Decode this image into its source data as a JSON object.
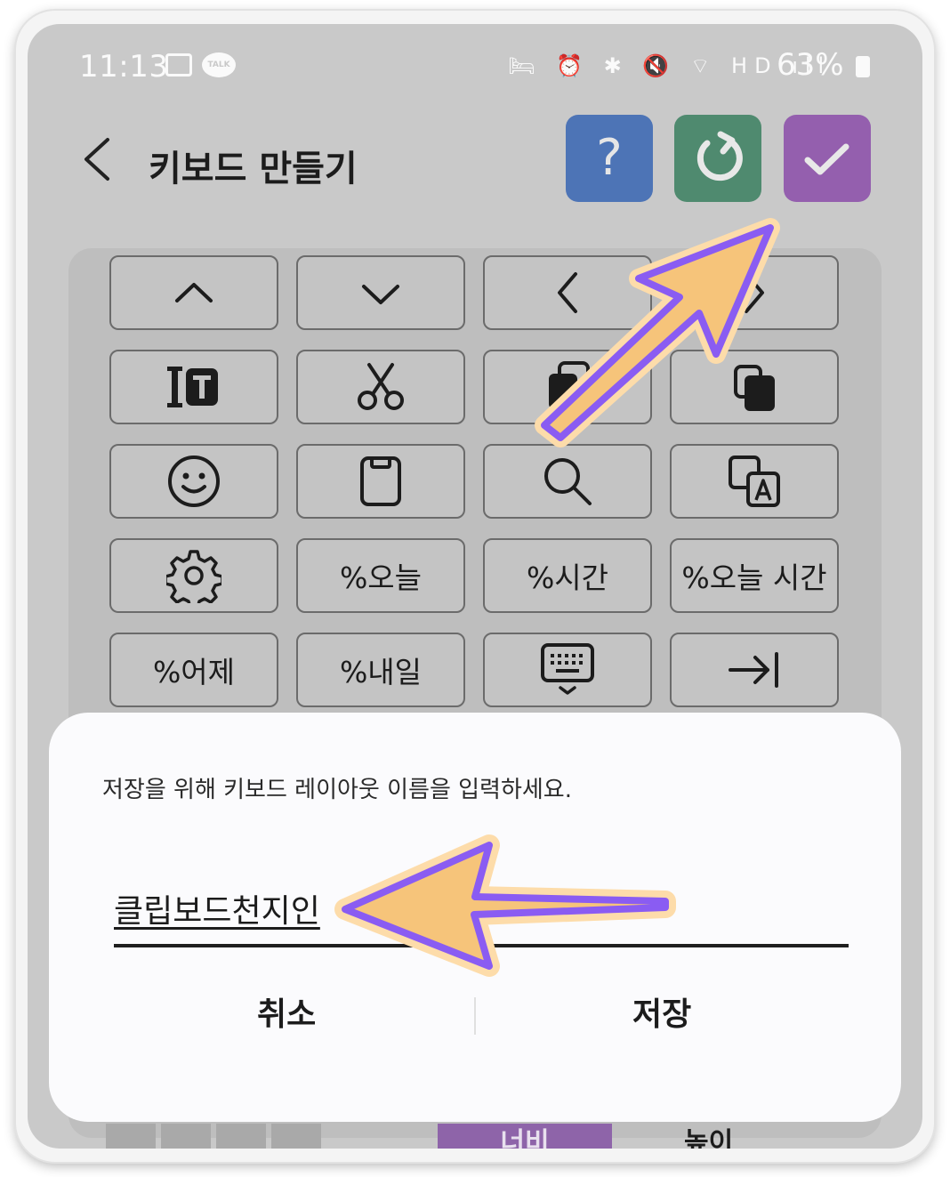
{
  "status_bar": {
    "time": "11:13",
    "talk_label": "TALK",
    "right_icons": "🛏 ⏰ ✱ 🔇 ⌔ HD ıll",
    "battery": "63%"
  },
  "app_bar": {
    "back_icon": "chevron-left-icon",
    "title": "키보드 만들기",
    "help_label": "?",
    "reset_icon": "refresh-icon",
    "confirm_icon": "check-icon",
    "colors": {
      "help": "#4d74b6",
      "reset": "#4f8a6f",
      "confirm": "#945fae"
    }
  },
  "keys": {
    "row1": [
      "chevron-up-icon",
      "chevron-down-icon",
      "chevron-left-icon",
      "chevron-right-icon"
    ],
    "row2": [
      "text-style-icon",
      "scissors-icon",
      "copy-icon",
      "paste-icon"
    ],
    "row3": [
      "emoji-icon",
      "clipboard-icon",
      "search-icon",
      "translate-icon"
    ],
    "row4": {
      "icon": "gear-icon",
      "today": "%오늘",
      "time": "%시간",
      "today_time": "%오늘 시간"
    },
    "row5": {
      "yesterday": "%어제",
      "tomorrow": "%내일",
      "icon_keyboard": "keyboard-hide-icon",
      "icon_tab": "tab-icon"
    }
  },
  "dialog": {
    "prompt": "저장을 위해 키보드 레이아웃 이름을 입력하세요.",
    "input_value": "클립보드천지인",
    "cancel": "취소",
    "save": "저장"
  },
  "bottom_bar": {
    "width_label": "너비",
    "height_label": "높이"
  }
}
